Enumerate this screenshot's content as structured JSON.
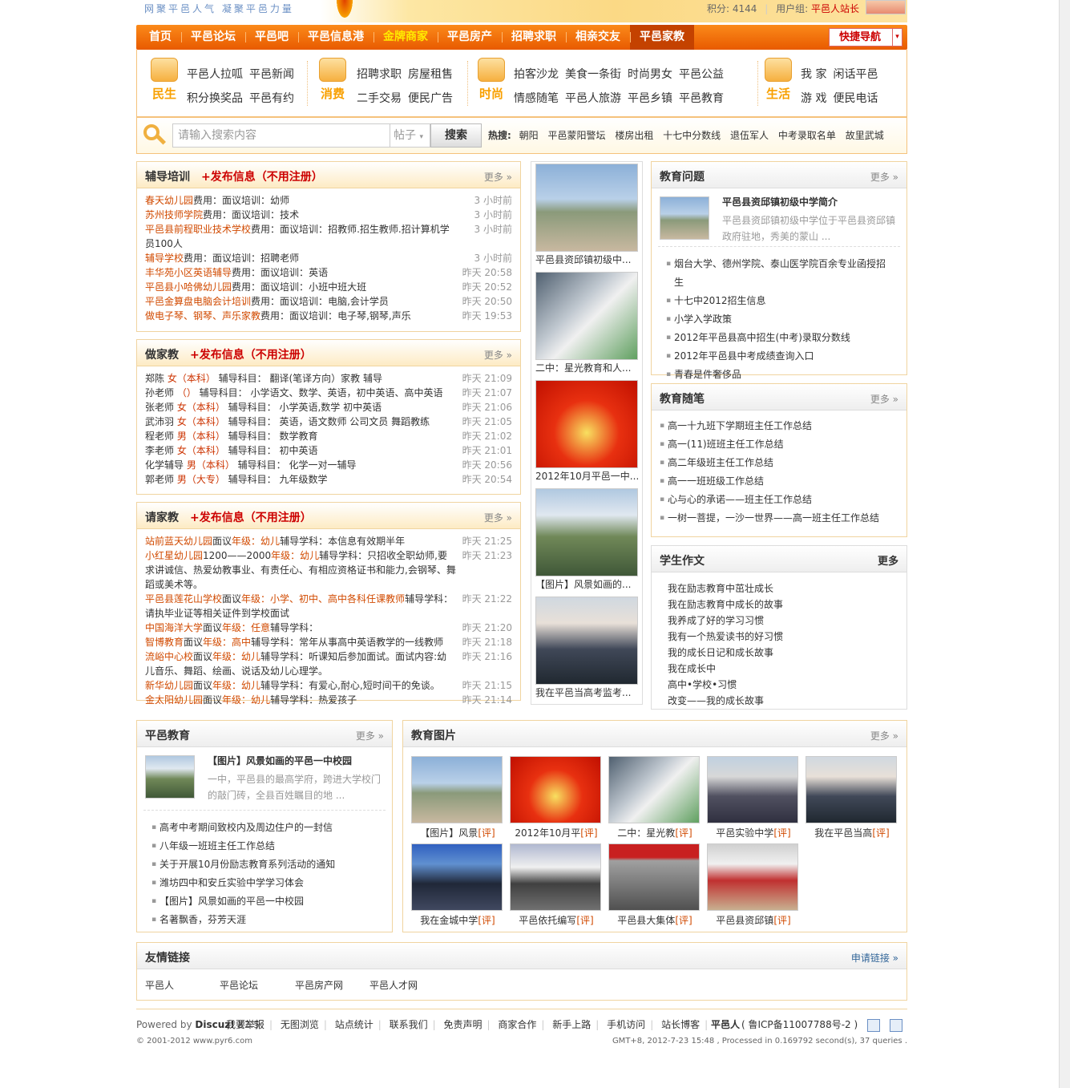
{
  "top": {
    "slogan": "网聚平邑人气 凝聚平邑力量",
    "points_label": "积分: 4144",
    "usergroup_label": "用户组:",
    "usergroup_value": "平邑人站长"
  },
  "nav": {
    "items": [
      "首页",
      "平邑论坛",
      "平邑吧",
      "平邑信息港",
      "金牌商家",
      "平邑房产",
      "招聘求职",
      "相亲交友",
      "平邑家教"
    ],
    "quick": "快捷导航",
    "quick_arrow": "▾"
  },
  "channels": [
    {
      "label": "民生",
      "links": [
        "平邑人拉呱",
        "平邑新闻",
        "积分换奖品",
        "平邑有约"
      ]
    },
    {
      "label": "消费",
      "links": [
        "招聘求职",
        "房屋租售",
        "二手交易",
        "便民广告"
      ]
    },
    {
      "label": "时尚",
      "links": [
        "拍客沙龙",
        "美食一条街",
        "时尚男女",
        "平邑公益",
        "情感随笔",
        "平邑人旅游",
        "平邑乡镇",
        "平邑教育"
      ]
    },
    {
      "label": "生活",
      "links": [
        "我 家",
        "闲话平邑",
        "游 戏",
        "便民电话"
      ]
    }
  ],
  "search": {
    "placeholder": "请输入搜索内容",
    "type": "帖子",
    "button": "搜索",
    "hot_label": "热搜:",
    "hot": [
      "朝阳",
      "平邑蒙阳警坛",
      "楼房出租",
      "十七中分数线",
      "退伍军人",
      "中考录取名单",
      "故里武城"
    ]
  },
  "tutoring": {
    "title": "辅导培训",
    "publish": "+发布信息（不用注册）",
    "more": "更多 »",
    "items": [
      {
        "org": "春天幼儿园",
        "fee": "费用：",
        "fee_v": "面议",
        "cat": "培训：",
        "cat_v": "幼师",
        "time": "3 小时前"
      },
      {
        "org": "苏州技师学院",
        "fee": "费用：",
        "fee_v": "面议",
        "cat": "培训：",
        "cat_v": "技术",
        "time": "3 小时前"
      },
      {
        "org": "平邑县前程职业技术学校",
        "fee": "费用：",
        "fee_v": "面议",
        "cat": "培训：",
        "cat_v": "招教师.招生教师.招计算机学员100人",
        "time": "3 小时前"
      },
      {
        "org": "辅导学校",
        "fee": "费用：",
        "fee_v": "面议",
        "cat": "培训：",
        "cat_v": "招聘老师",
        "time": "3 小时前"
      },
      {
        "org": "丰华苑小区英语辅导",
        "fee": "费用：",
        "fee_v": "面议",
        "cat": "培训：",
        "cat_v": "英语",
        "time": "昨天 20:58"
      },
      {
        "org": "平邑县小哈佛幼儿园",
        "fee": "费用：",
        "fee_v": "面议",
        "cat": "培训：",
        "cat_v": "小班中班大班",
        "time": "昨天 20:52"
      },
      {
        "org": "平邑金算盘电脑会计培训",
        "fee": "费用：",
        "fee_v": "面议",
        "cat": "培训：",
        "cat_v": "电脑,会计学员",
        "time": "昨天 20:50"
      },
      {
        "org": "做电子琴、钢琴、声乐家教",
        "fee": "费用：",
        "fee_v": "面议",
        "cat": "培训：",
        "cat_v": "电子琴,钢琴,声乐",
        "time": "昨天 19:53"
      }
    ]
  },
  "tutor": {
    "title": "做家教",
    "publish": "+发布信息（不用注册）",
    "more": "更多 »",
    "items": [
      {
        "name": "郑陈",
        "info": "女（本科）",
        "subj_label": "辅导科目：",
        "subj": "翻译(笔译方向）家教 辅导",
        "time": "昨天 21:09"
      },
      {
        "name": "孙老师",
        "info": "（）",
        "subj_label": "辅导科目：",
        "subj": "小学语文、数学、英语，初中英语、高中英语",
        "time": "昨天 21:07"
      },
      {
        "name": "张老师",
        "info": "女（本科）",
        "subj_label": "辅导科目：",
        "subj": "小学英语,数学 初中英语",
        "time": "昨天 21:06"
      },
      {
        "name": "武沛羽",
        "info": "女（本科）",
        "subj_label": "辅导科目：",
        "subj": "英语，语文数师 公司文员 舞蹈教练",
        "time": "昨天 21:05"
      },
      {
        "name": "程老师",
        "info": "男（本科）",
        "subj_label": "辅导科目：",
        "subj": "数学教育",
        "time": "昨天 21:02"
      },
      {
        "name": "李老师",
        "info": "女（本科）",
        "subj_label": "辅导科目：",
        "subj": "初中英语",
        "time": "昨天 21:01"
      },
      {
        "name": "化学辅导",
        "info": "男（本科）",
        "subj_label": "辅导科目：",
        "subj": "化学一对一辅导",
        "time": "昨天 20:56"
      },
      {
        "name": "郭老师",
        "info": "男（大专）",
        "subj_label": "辅导科目：",
        "subj": "九年级数学",
        "time": "昨天 20:54"
      }
    ]
  },
  "hire": {
    "title": "请家教",
    "publish": "+发布信息（不用注册）",
    "more": "更多 »",
    "items": [
      {
        "org": "站前蓝天幼儿园",
        "a": "面议",
        "g_label": "年级：",
        "g": "幼儿",
        "s_label": "辅导学科：",
        "s": "本信息有效期半年",
        "time": "昨天 21:25"
      },
      {
        "org": "小红星幼儿园",
        "a": "1200——2000",
        "g_label": "年级：",
        "g": "幼儿",
        "s_label": "辅导学科：",
        "s": "只招收全职幼师,要求讲诚信、热爱幼教事业、有责任心、有相应资格证书和能力,会钢琴、舞蹈或美术等。",
        "time": "昨天 21:23"
      },
      {
        "org": "平邑县莲花山学校",
        "a": "面议",
        "g_label": "年级：",
        "g": "小学、初中、高中各科任课教师",
        "s_label": "辅导学科：",
        "s": "请执毕业证等相关证件到学校面试",
        "time": "昨天 21:22"
      },
      {
        "org": "中国海洋大学",
        "a": "面议",
        "g_label": "年级：",
        "g": "任意",
        "s_label": "辅导学科：",
        "s": "",
        "time": "昨天 21:20"
      },
      {
        "org": "智博教育",
        "a": "面议",
        "g_label": "年级：",
        "g": "高中",
        "s_label": "辅导学科：",
        "s": "常年从事高中英语教学的一线教师",
        "time": "昨天 21:18"
      },
      {
        "org": "流峪中心校",
        "a": "面议",
        "g_label": "年级：",
        "g": "幼儿",
        "s_label": "辅导学科：",
        "s": "听课知后参加面试。面试内容:幼儿音乐、舞蹈、绘画、说话及幼儿心理学。",
        "time": "昨天 21:16"
      },
      {
        "org": "新华幼儿园",
        "a": "面议",
        "g_label": "年级：",
        "g": "幼儿",
        "s_label": "辅导学科：",
        "s": "有爱心,耐心,短时间干的免谈。",
        "time": "昨天 21:15"
      },
      {
        "org": "金太阳幼儿园",
        "a": "面议",
        "g_label": "年级：",
        "g": "幼儿",
        "s_label": "辅导学科：",
        "s": "热爱孩子",
        "time": "昨天 21:14"
      }
    ]
  },
  "photocol": [
    {
      "cap": "平邑县资邱镇初级中..."
    },
    {
      "cap": "二中：星光教育和人..."
    },
    {
      "cap": "2012年10月平邑一中..."
    },
    {
      "cap": "【图片】风景如画的..."
    },
    {
      "cap": "我在平邑当高考监考..."
    }
  ],
  "eduq": {
    "title": "教育问题",
    "more": "更多 »",
    "feat_title": "平邑县资邱镇初级中学简介",
    "feat_summary": "平邑县资邱镇初级中学位于平邑县资邱镇政府驻地，秀美的蒙山 ...",
    "items": [
      "烟台大学、德州学院、泰山医学院百余专业函授招生",
      "十七中2012招生信息",
      "小学入学政策",
      "2012年平邑县高中招生(中考)录取分数线",
      "2012年平邑县中考成绩查询入口",
      "青春是件奢侈品"
    ]
  },
  "essay": {
    "title": "教育随笔",
    "more": "更多 »",
    "items": [
      "高一十九班下学期班主任工作总结",
      "高一(11)班班主任工作总结",
      "高二年级班主任工作总结",
      "高一一班班级工作总结",
      "心与心的承诺——班主任工作总结",
      "一树一菩提，一沙一世界——高一班主任工作总结"
    ]
  },
  "student": {
    "title": "学生作文",
    "more": "更多",
    "items": [
      "我在励志教育中茁壮成长",
      "我在励志教育中成长的故事",
      "我养成了好的学习习惯",
      "我有一个热爱读书的好习惯",
      "我的成长日记和成长故事",
      "我在成长中",
      "高中•学校•习惯",
      "改变——我的成长故事"
    ]
  },
  "pyedu": {
    "title": "平邑教育",
    "more": "更多 »",
    "feat_title": "【图片】风景如画的平邑一中校园",
    "feat_summary": "一中，平邑县的最高学府，跨进大学校门的敲门砖，全县百姓瞩目的地 ...",
    "items": [
      "高考中考期间致校内及周边住户的一封信",
      "八年级一班班主任工作总结",
      "关于开展10月份励志教育系列活动的通知",
      "潍坊四中和安丘实验中学学习体会",
      "【图片】风景如画的平邑一中校园",
      "名著飘香，芬芳天涯"
    ]
  },
  "edupics": {
    "title": "教育图片",
    "more": "更多 »",
    "ping": "[评]",
    "items": [
      "【图片】风景",
      "2012年10月平",
      "二中：星光教",
      "平邑实验中学",
      "我在平邑当高",
      "我在金城中学",
      "平邑依托编写",
      "平邑县大集体",
      "平邑县资邱镇"
    ]
  },
  "links": {
    "title": "友情链接",
    "apply": "申请链接 »",
    "items": [
      "平邑人",
      "平邑论坛",
      "平邑房产网",
      "平邑人才网"
    ]
  },
  "footer": {
    "powered": "Powered by",
    "discuz": "Discuz!",
    "version": "X2.5",
    "copyright": "© 2001-2012 www.pyr6.com",
    "links": [
      "我要举报",
      "无图浏览",
      "站点统计",
      "联系我们",
      "免责声明",
      "商家合作",
      "新手上路",
      "手机访问",
      "站长博客"
    ],
    "site": "平邑人",
    "icp": "( 鲁ICP备11007788号-2 )",
    "gmt": "GMT+8, 2012-7-23 15:48 , Processed in 0.169792 second(s), 37 queries ."
  }
}
